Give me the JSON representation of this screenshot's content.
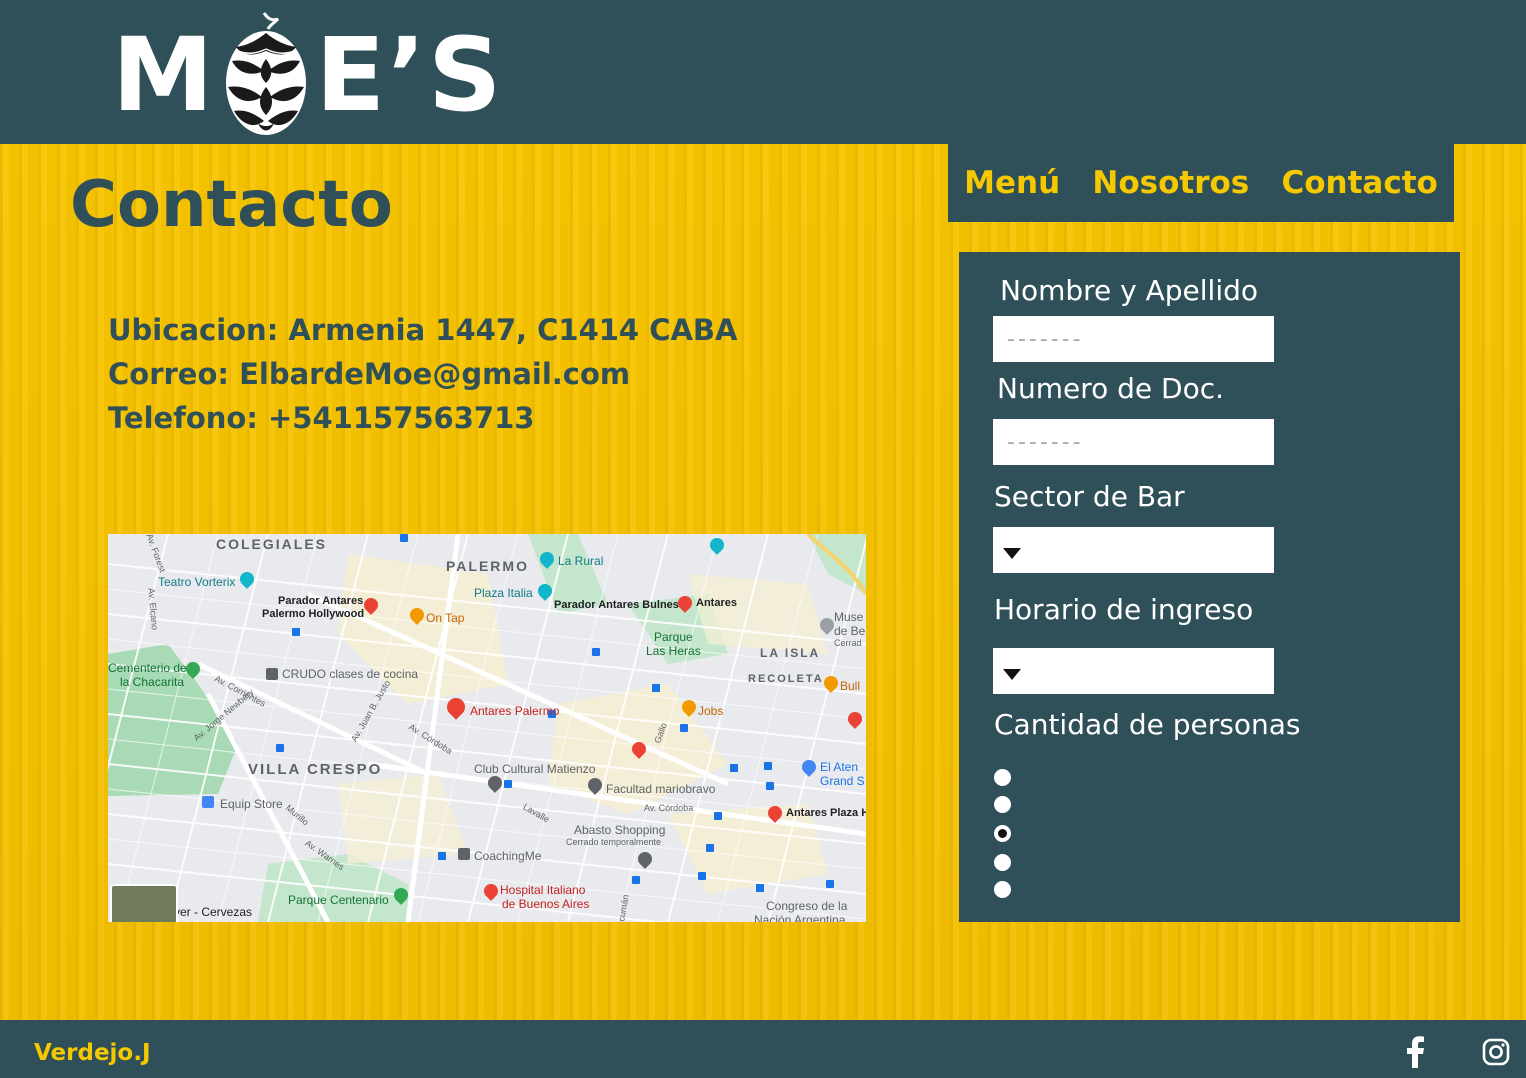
{
  "brand": {
    "logo_left": "M",
    "logo_right": "E’S",
    "logo_full": "MOE’S"
  },
  "nav": {
    "items": [
      {
        "label": "Menú"
      },
      {
        "label": "Nosotros"
      },
      {
        "label": "Contacto"
      }
    ]
  },
  "page": {
    "title": "Contacto"
  },
  "contact": {
    "location": "Ubicacion: Armenia 1447, C1414 CABA",
    "email": "Correo: ElbardeMoe@gmail.com",
    "phone": "Telefono: +541157563713"
  },
  "map": {
    "labels": {
      "colegiales": "COLEGIALES",
      "palermo": "PALERMO",
      "la_rural": "La Rural",
      "teatro_vorterix": "Teatro Vorterix",
      "palermo_italia": "Plaza Italia",
      "parador_bulnes": "Parador Antares Bulnes",
      "antares": "Antares",
      "parador_hollywood_1": "Parador Antares",
      "parador_hollywood_2": "Palermo Hollywood",
      "on_tap": "On Tap",
      "museo_1": "Muse",
      "museo_2": "de Be",
      "museo_3": "Cerrad",
      "parque_las_heras_1": "Parque",
      "parque_las_heras_2": "Las Heras",
      "la_isla": "LA ISLA",
      "cementerio_1": "Cementerio de",
      "cementerio_2": "la Chacarita",
      "crudo": "CRUDO clases de cocina",
      "recoleta": "RECOLETA",
      "bull": "Bull",
      "antares_palermo": "Antares Palermo",
      "jobs": "Jobs",
      "villa_crespo": "VILLA CRESPO",
      "club_cultural": "Club Cultural Matienzo",
      "el_ateneo_1": "El Aten",
      "el_ateneo_2": "Grand S",
      "facultad": "Facultad mariobravo",
      "equip_store": "Equip Store",
      "antares_plaza": "Antares Plaza H",
      "abasto_1": "Abasto Shopping",
      "abasto_2": "Cerrado temporalmente",
      "coachingme": "CoachingMe",
      "hospital_1": "Hospital Italiano",
      "hospital_2": "de Buenos Aires",
      "parque_centenario": "Parque Centenario",
      "cervezas": "ver - Cervezas",
      "congreso_1": "Congreso de la",
      "congreso_2": "Nación Argentina",
      "av_forest": "Av. Forest",
      "av_elcano": "Av. Elcano",
      "av_corrientes": "Av. Corrientes",
      "av_newbery": "Av. Jorge Newbery",
      "av_justo": "Av. Juan B. Justo",
      "av_cordoba": "Av. Córdoba",
      "av_cordoba_2": "Av. Córdoba",
      "gallo": "Gallo",
      "lavalle": "Lavalle",
      "murillo": "Murillo",
      "av_warnes": "Av. Warnes",
      "tucuman": "Tucumán"
    }
  },
  "form": {
    "name_label": "Nombre y Apellido",
    "name_placeholder": "-------",
    "doc_label": "Numero de Doc.",
    "doc_placeholder": "-------",
    "sector_label": "Sector de Bar",
    "sector_value": "",
    "time_label": "Horario de ingreso",
    "time_value": "",
    "people_label": "Cantidad de personas",
    "people_options": [
      {
        "value": "1",
        "checked": false
      },
      {
        "value": "2",
        "checked": false
      },
      {
        "value": "3",
        "checked": true
      },
      {
        "value": "4",
        "checked": false
      },
      {
        "value": "5",
        "checked": false
      }
    ]
  },
  "footer": {
    "credit": "Verdejo.J",
    "social": [
      "facebook-icon",
      "instagram-icon"
    ]
  },
  "colors": {
    "primary_dark": "#2f5058",
    "accent_yellow": "#f5c800",
    "background_yellow": "#f6c200"
  }
}
